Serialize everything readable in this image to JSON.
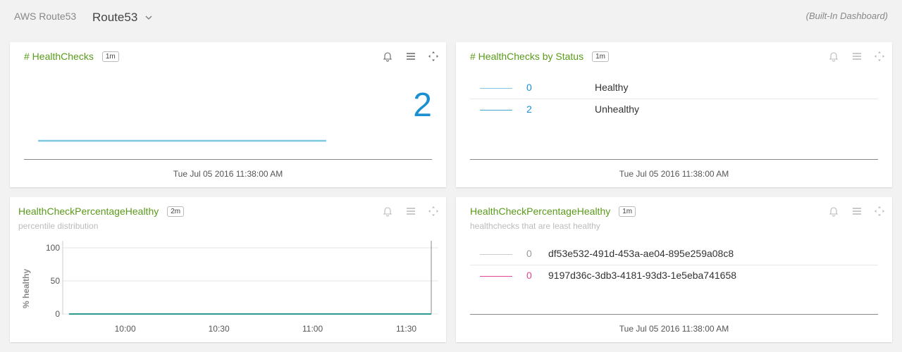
{
  "header": {
    "brand": "AWS Route53",
    "dashboard": "Route53",
    "builtin": "(Built-In Dashboard)"
  },
  "panels": [
    {
      "title": "# HealthChecks",
      "interval": "1m",
      "big_value": "2",
      "timestamp": "Tue Jul 05 2016 11:38:00 AM"
    },
    {
      "title": "# HealthChecks by Status",
      "interval": "1m",
      "rows": [
        {
          "value": "0",
          "label": "Healthy",
          "color": "#7ec8e3"
        },
        {
          "value": "2",
          "label": "Unhealthy",
          "color": "#4aa8d8"
        }
      ],
      "timestamp": "Tue Jul 05 2016 11:38:00 AM"
    },
    {
      "title": "HealthCheckPercentageHealthy",
      "interval": "2m",
      "subtitle": "percentile distribution"
    },
    {
      "title": "HealthCheckPercentageHealthy",
      "interval": "1m",
      "subtitle": "healthchecks that are least healthy",
      "rows": [
        {
          "value": "0",
          "label": "df53e532-491d-453a-ae04-895e259a08c8",
          "color": "#cccccc",
          "value_color": "#999999"
        },
        {
          "value": "0",
          "label": "9197d36c-3db3-4181-93d3-1e5eba741658",
          "color": "#e0458f",
          "value_color": "#e0458f"
        }
      ],
      "timestamp": "Tue Jul 05 2016 11:38:00 AM"
    }
  ],
  "chart_data": {
    "type": "line",
    "title": "",
    "xlabel": "",
    "ylabel": "% healthy",
    "x_ticks": [
      "10:00",
      "10:30",
      "11:00",
      "11:30"
    ],
    "y_ticks": [
      0,
      50,
      100
    ],
    "ylim": [
      0,
      100
    ],
    "grid": true,
    "series": [
      {
        "color": "#2a9d8f",
        "x": [
          "09:42",
          "11:38"
        ],
        "values": [
          0,
          0
        ]
      }
    ]
  }
}
